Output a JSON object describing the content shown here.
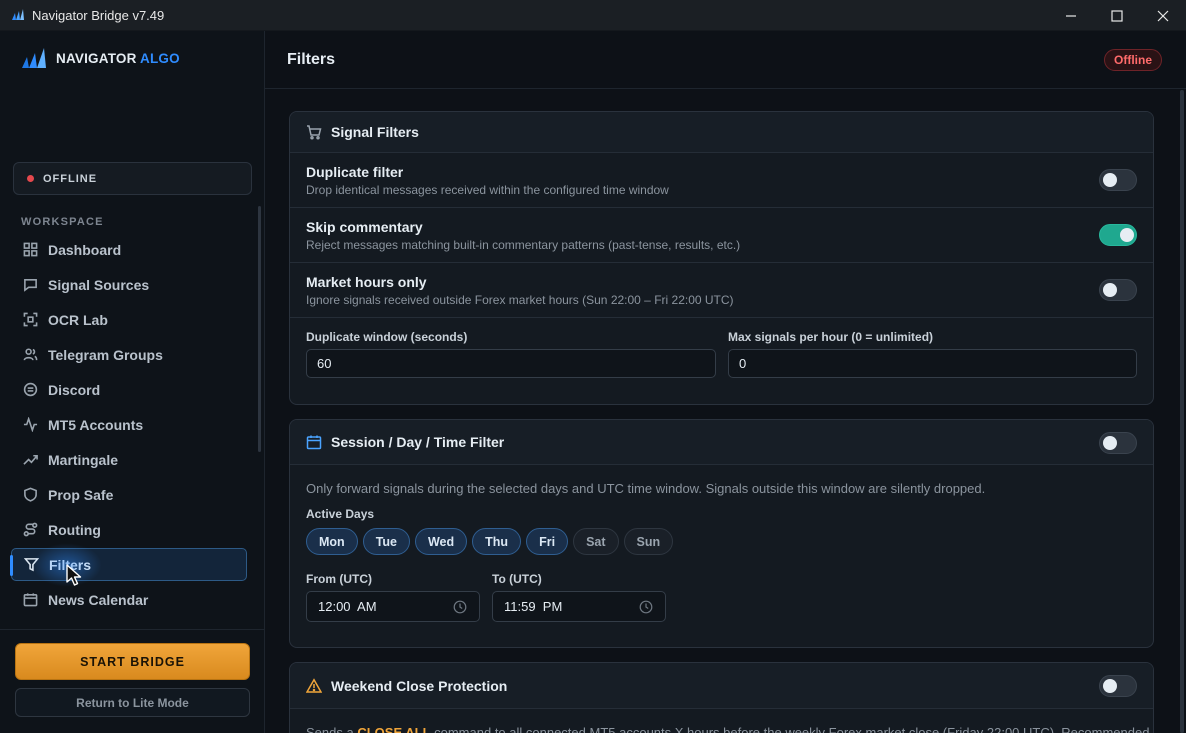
{
  "window": {
    "title": "Navigator Bridge v7.49",
    "controls": [
      "minimize-icon",
      "maximize-icon",
      "close-icon"
    ]
  },
  "sidebar": {
    "logo": {
      "part1": "NAVIGATOR",
      "part2": "ALGO"
    },
    "status": {
      "label": "OFFLINE",
      "color": "#e5484d"
    },
    "section_label": "WORKSPACE",
    "items": [
      {
        "label": "Dashboard",
        "icon": "grid-icon"
      },
      {
        "label": "Signal Sources",
        "icon": "message-icon"
      },
      {
        "label": "OCR Lab",
        "icon": "scan-icon"
      },
      {
        "label": "Telegram Groups",
        "icon": "users-icon"
      },
      {
        "label": "Discord",
        "icon": "discord-icon"
      },
      {
        "label": "MT5 Accounts",
        "icon": "activity-icon"
      },
      {
        "label": "Martingale",
        "icon": "trend-icon"
      },
      {
        "label": "Prop Safe",
        "icon": "shield-icon"
      },
      {
        "label": "Routing",
        "icon": "route-icon"
      },
      {
        "label": "Filters",
        "icon": "filter-icon",
        "active": true
      },
      {
        "label": "News Calendar",
        "icon": "calendar-icon"
      }
    ],
    "start_button": "START BRIDGE",
    "lite_button": "Return to Lite Mode"
  },
  "header": {
    "title": "Filters",
    "status_badge": "Offline"
  },
  "signal_filters": {
    "title": "Signal Filters",
    "rows": [
      {
        "title": "Duplicate filter",
        "desc": "Drop identical messages received within the configured time window",
        "enabled": false
      },
      {
        "title": "Skip commentary",
        "desc": "Reject messages matching built-in commentary patterns (past-tense, results, etc.)",
        "enabled": true
      },
      {
        "title": "Market hours only",
        "desc": "Ignore signals received outside Forex market hours (Sun 22:00 – Fri 22:00 UTC)",
        "enabled": false
      }
    ],
    "duplicate_window": {
      "label": "Duplicate window (seconds)",
      "value": "60"
    },
    "max_signals": {
      "label": "Max signals per hour (0 = unlimited)",
      "value": "0"
    }
  },
  "session_filter": {
    "title": "Session / Day / Time Filter",
    "enabled": false,
    "desc": "Only forward signals during the selected days and UTC time window. Signals outside this window are silently dropped.",
    "days_label": "Active Days",
    "days": [
      {
        "label": "Mon",
        "selected": true
      },
      {
        "label": "Tue",
        "selected": true
      },
      {
        "label": "Wed",
        "selected": true
      },
      {
        "label": "Thu",
        "selected": true
      },
      {
        "label": "Fri",
        "selected": true
      },
      {
        "label": "Sat",
        "selected": false
      },
      {
        "label": "Sun",
        "selected": false
      }
    ],
    "from": {
      "label": "From (UTC)",
      "value": "12:00  AM"
    },
    "to": {
      "label": "To (UTC)",
      "value": "11:59  PM"
    }
  },
  "weekend_close": {
    "title": "Weekend Close Protection",
    "enabled": false,
    "desc_pre": "Sends a ",
    "desc_highlight": "CLOSE ALL",
    "desc_post": " command to all connected MT5 accounts X hours before the weekly Forex market close (Friday 22:00 UTC). Recommended"
  },
  "colors": {
    "accent": "#2f8cff",
    "toggle_on": "#1fa88f",
    "start_button": "#f0a53a",
    "offline": "#ff6b6b"
  }
}
